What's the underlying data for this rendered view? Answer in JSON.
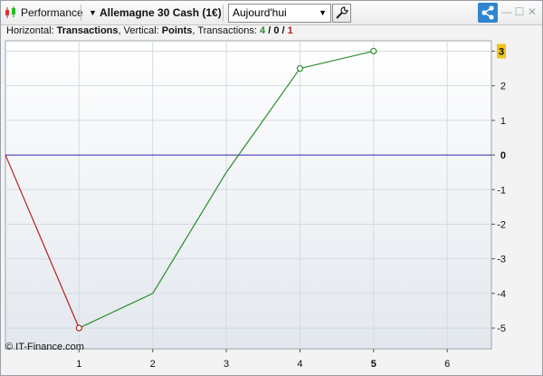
{
  "toolbar": {
    "performance_label": "Performance",
    "instrument_label": "Allemagne 30 Cash (1€)",
    "period_value": "Aujourd'hui",
    "icons": [
      "candlestick-icon",
      "chevron-down-icon",
      "wrench-icon",
      "share-icon",
      "minimize-icon",
      "maximize-icon",
      "close-icon"
    ]
  },
  "info": {
    "prefix_h": "Horizontal: ",
    "horizontal": "Transactions",
    "prefix_v": ", Vertical: ",
    "vertical": "Points",
    "prefix_t": ", Transactions: ",
    "wins": "4",
    "slash1": " / ",
    "neutral": "0",
    "slash2": " / ",
    "losses": "1"
  },
  "copyright": "© IT-Finance.com",
  "colors": {
    "gain": "#2a8c2a",
    "loss": "#b22222",
    "zero_line": "#2b2bb0",
    "last_value_badge": "#f0c419"
  },
  "chart_data": {
    "type": "line",
    "xlabel": "Transactions",
    "ylabel": "Points",
    "x": [
      0,
      1,
      2,
      3,
      4,
      5
    ],
    "y": [
      0,
      -5,
      -4,
      -0.5,
      2.5,
      3
    ],
    "marked_points": [
      1,
      4,
      5
    ],
    "xlim": [
      0,
      6.6
    ],
    "ylim": [
      -5.6,
      3.3
    ],
    "x_ticks": [
      "1",
      "2",
      "3",
      "4",
      "5",
      "6"
    ],
    "y_ticks": [
      "3",
      "2",
      "1",
      "0",
      "-1",
      "-2",
      "-3",
      "-4",
      "-5"
    ],
    "last_value": "3",
    "highlighted_x_tick": "5",
    "grid": true
  }
}
